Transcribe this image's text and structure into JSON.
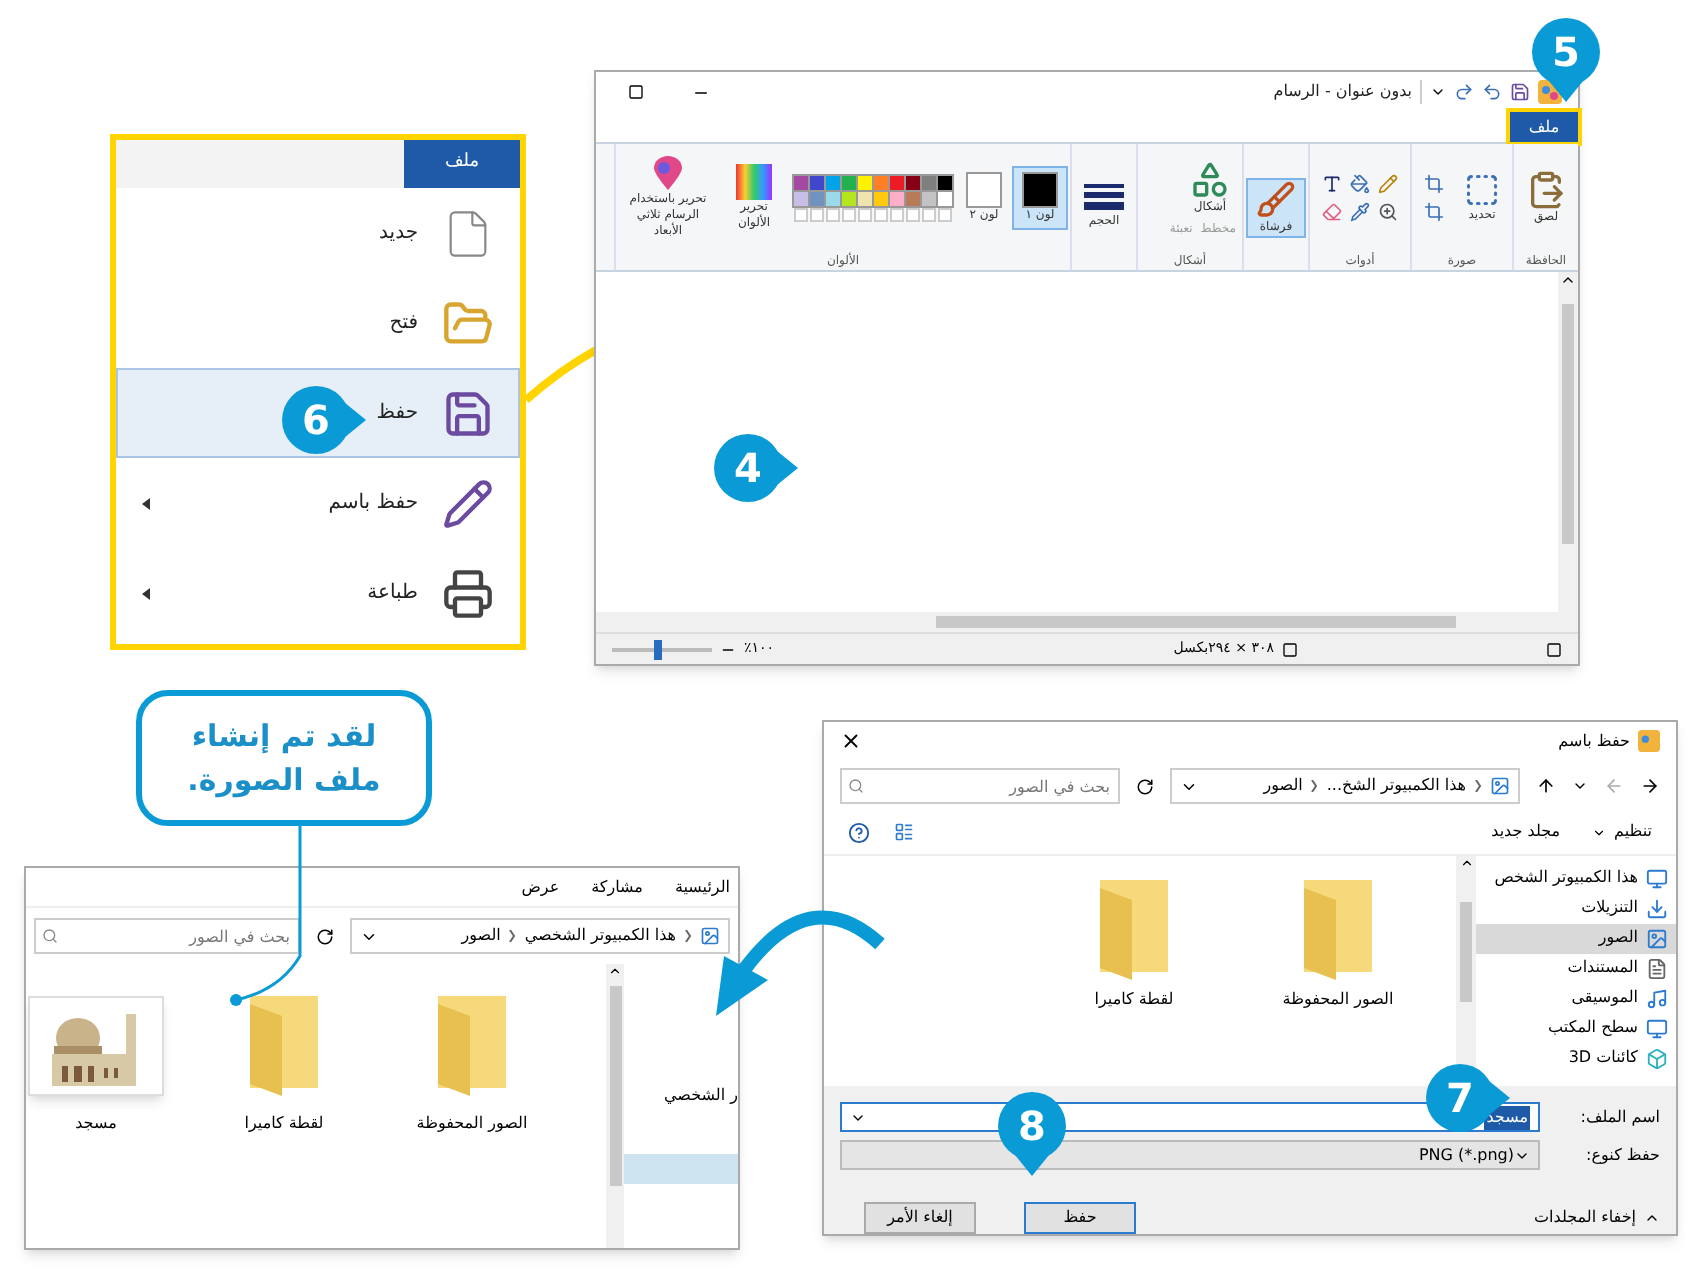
{
  "paint_window": {
    "title": "بدون عنوان - الرسام",
    "tabs": [
      {
        "label": "ملف",
        "selected": true
      }
    ],
    "tab_marker": {
      "number": "5"
    },
    "ribbon": [
      {
        "label": "الحافظة",
        "tools": [
          {
            "kind": "paste",
            "label": "لصق",
            "selected": false
          }
        ]
      },
      {
        "label": "صورة",
        "tools": [
          {
            "kind": "select",
            "label": "تحديد",
            "selected": false
          },
          {
            "kind": "image-tools",
            "selected": false
          }
        ]
      },
      {
        "label": "أدوات",
        "tools": [
          {
            "kind": "tool-grid",
            "selected": false
          }
        ]
      },
      {
        "tools": [
          {
            "kind": "brushes",
            "label": "فرشاة",
            "selected": true
          }
        ]
      },
      {
        "label": "أشكال",
        "tools": [
          {
            "kind": "shapes",
            "label": "أشكال",
            "selected": false
          },
          {
            "kind": "shape-options",
            "label": "مخطط",
            "selected": false
          },
          {
            "kind": "shape-options",
            "label": "تعبئة",
            "selected": false
          }
        ]
      },
      {
        "tools": [
          {
            "kind": "size",
            "label": "الحجم",
            "selected": false
          }
        ]
      },
      {
        "label": "الألوان",
        "tools": [
          {
            "kind": "color",
            "label": "لون ١",
            "color": "#000000",
            "selected": true
          },
          {
            "kind": "color",
            "label": "لون ٢",
            "color": "#ffffff",
            "selected": false
          },
          {
            "kind": "palette"
          },
          {
            "kind": "edit-colors",
            "label": "تحرير الألوان",
            "selected": false
          },
          {
            "kind": "paint3d",
            "label": "تحرير باستخدام الرسام ثلاثي الأبعاد",
            "selected": false
          }
        ]
      }
    ],
    "palette": [
      {
        "color": "#000000"
      },
      {
        "color": "#7f7f7f"
      },
      {
        "color": "#880015"
      },
      {
        "color": "#ed1c24"
      },
      {
        "color": "#ff7f27"
      },
      {
        "color": "#fff200"
      },
      {
        "color": "#22b14c"
      },
      {
        "color": "#00a2e8"
      },
      {
        "color": "#3f48cc"
      },
      {
        "color": "#a349a4"
      },
      {
        "color": "#ffffff"
      },
      {
        "color": "#c3c3c3"
      },
      {
        "color": "#b97a57"
      },
      {
        "color": "#ffaec9"
      },
      {
        "color": "#ffc90e"
      },
      {
        "color": "#efe4b0"
      },
      {
        "color": "#b5e61d"
      },
      {
        "color": "#99d9ea"
      },
      {
        "color": "#7092be"
      },
      {
        "color": "#c8bfe7"
      }
    ],
    "canvas_marker": {
      "number": "4"
    },
    "status": {
      "canvas_size": "٣٠٨ × ٢٩٤بكسل",
      "zoom": "١٠٠٪",
      "zoom_slider": {
        "level": 0.45
      }
    }
  },
  "file_menu": {
    "title": "ملف",
    "items": [
      {
        "kind": "new",
        "label": "جديد",
        "selected": false,
        "submenu": false
      },
      {
        "kind": "open",
        "label": "فتح",
        "selected": false,
        "submenu": false
      },
      {
        "kind": "save",
        "label": "حفظ",
        "selected": true,
        "submenu": false
      },
      {
        "kind": "save-as",
        "label": "حفظ باسم",
        "selected": false,
        "submenu": true
      },
      {
        "kind": "print",
        "label": "طباعة",
        "selected": false,
        "submenu": true
      }
    ],
    "marker": {
      "number": "6"
    }
  },
  "callout": {
    "text": "لقد تم إنشاء ملف الصورة."
  },
  "save_dialog": {
    "title": "حفظ باسم",
    "path": [
      "هذا الكمبيوتر الشخ...",
      "الصور"
    ],
    "search": {
      "placeholder": "بحث في الصور"
    },
    "toolbar": [
      "تنظيم",
      "مجلد جديد"
    ],
    "nav": [
      {
        "kind": "pc",
        "label": "هذا الكمبيوتر الشخص",
        "selected": false
      },
      {
        "kind": "downloads",
        "label": "التنزيلات",
        "selected": false
      },
      {
        "kind": "pictures",
        "label": "الصور",
        "selected": true
      },
      {
        "kind": "documents",
        "label": "المستندات",
        "selected": false
      },
      {
        "kind": "music",
        "label": "الموسيقى",
        "selected": false
      },
      {
        "kind": "desktop",
        "label": "سطح المكتب",
        "selected": false
      },
      {
        "kind": "objects3d",
        "label": "كائنات 3D",
        "selected": false
      }
    ],
    "files": [
      {
        "kind": "folder",
        "name": "الصور المحفوظة"
      },
      {
        "kind": "folder",
        "name": "لقطة كاميرا"
      }
    ],
    "filename": {
      "label": "اسم الملف:",
      "value": "مسجد"
    },
    "filetype": {
      "label": "حفظ كنوع:",
      "value": "PNG (*.png)"
    },
    "hide_folders": "إخفاء المجلدات",
    "buttons": [
      "حفظ",
      "إلغاء الأمر"
    ],
    "filename_marker": {
      "number": "7"
    },
    "save_marker": {
      "number": "8"
    }
  },
  "explorer": {
    "tabs": [
      "الرئيسية",
      "مشاركة",
      "عرض"
    ],
    "path": [
      "هذا الكمبيوتر الشخصي",
      "الصور"
    ],
    "search": {
      "placeholder": "بحث في الصور"
    },
    "nav": [
      {
        "label": "ر الشخصي",
        "selected": false
      },
      {
        "selected": true
      }
    ],
    "files": [
      {
        "kind": "folder",
        "name": "الصور المحفوظة"
      },
      {
        "kind": "folder",
        "name": "لقطة كاميرا"
      },
      {
        "kind": "image",
        "name": "مسجد"
      }
    ]
  }
}
